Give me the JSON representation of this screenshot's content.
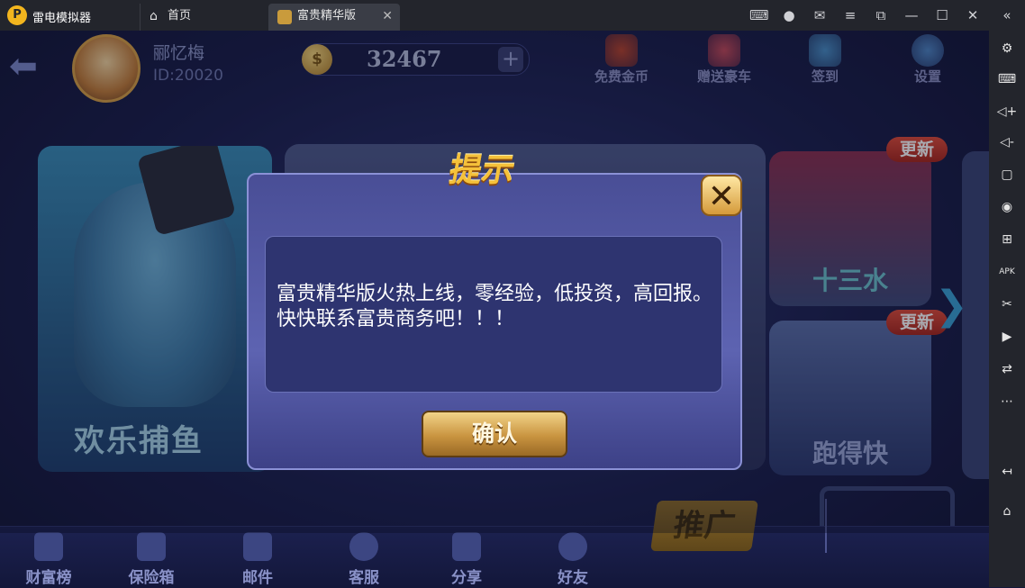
{
  "emulator": {
    "logo_glyph": "P",
    "app_name": "雷电模拟器",
    "tabs": [
      {
        "label": "首页",
        "icon": "home-icon"
      },
      {
        "label": "富贵精华版",
        "icon": "game-icon",
        "close": "✕"
      }
    ],
    "title_icons": [
      "gamepad-icon",
      "user-icon",
      "mail-icon",
      "menu-icon",
      "restore-icon",
      "minimize-icon",
      "maximize-icon",
      "close-icon",
      "collapse-icon"
    ],
    "sidebar_icons": [
      "settings-icon",
      "keyboard-icon",
      "volume-up-icon",
      "volume-down-icon",
      "fullscreen-icon",
      "record-icon",
      "multi-instance-icon",
      "apk-icon",
      "scissors-icon",
      "video-icon",
      "sync-icon",
      "more-icon",
      "back-icon",
      "home-icon"
    ]
  },
  "header": {
    "user_name": "郦忆梅",
    "user_id": "ID:20020",
    "coin_symbol": "$",
    "coins": "32467",
    "plus": "+",
    "buttons": [
      {
        "label": "免费金币"
      },
      {
        "label": "赠送豪车"
      },
      {
        "label": "签到"
      },
      {
        "label": "设置"
      }
    ]
  },
  "games": {
    "fishing": "欢乐捕鱼",
    "thirteen": "十三水",
    "pdk": "跑得快",
    "new_badge": "更新"
  },
  "bottom": {
    "items": [
      {
        "label": "财富榜"
      },
      {
        "label": "保险箱"
      },
      {
        "label": "邮件"
      },
      {
        "label": "客服"
      },
      {
        "label": "分享"
      },
      {
        "label": "好友"
      }
    ],
    "promo": "推广"
  },
  "dialog": {
    "title": "提示",
    "message": "富贵精华版火热上线，零经验，低投资，高回报。快快联系富贵商务吧！！！",
    "confirm": "确认",
    "close": "✕"
  },
  "colors": {
    "accent_gold": "#f5c13a",
    "bg": "#1b1f4d"
  }
}
